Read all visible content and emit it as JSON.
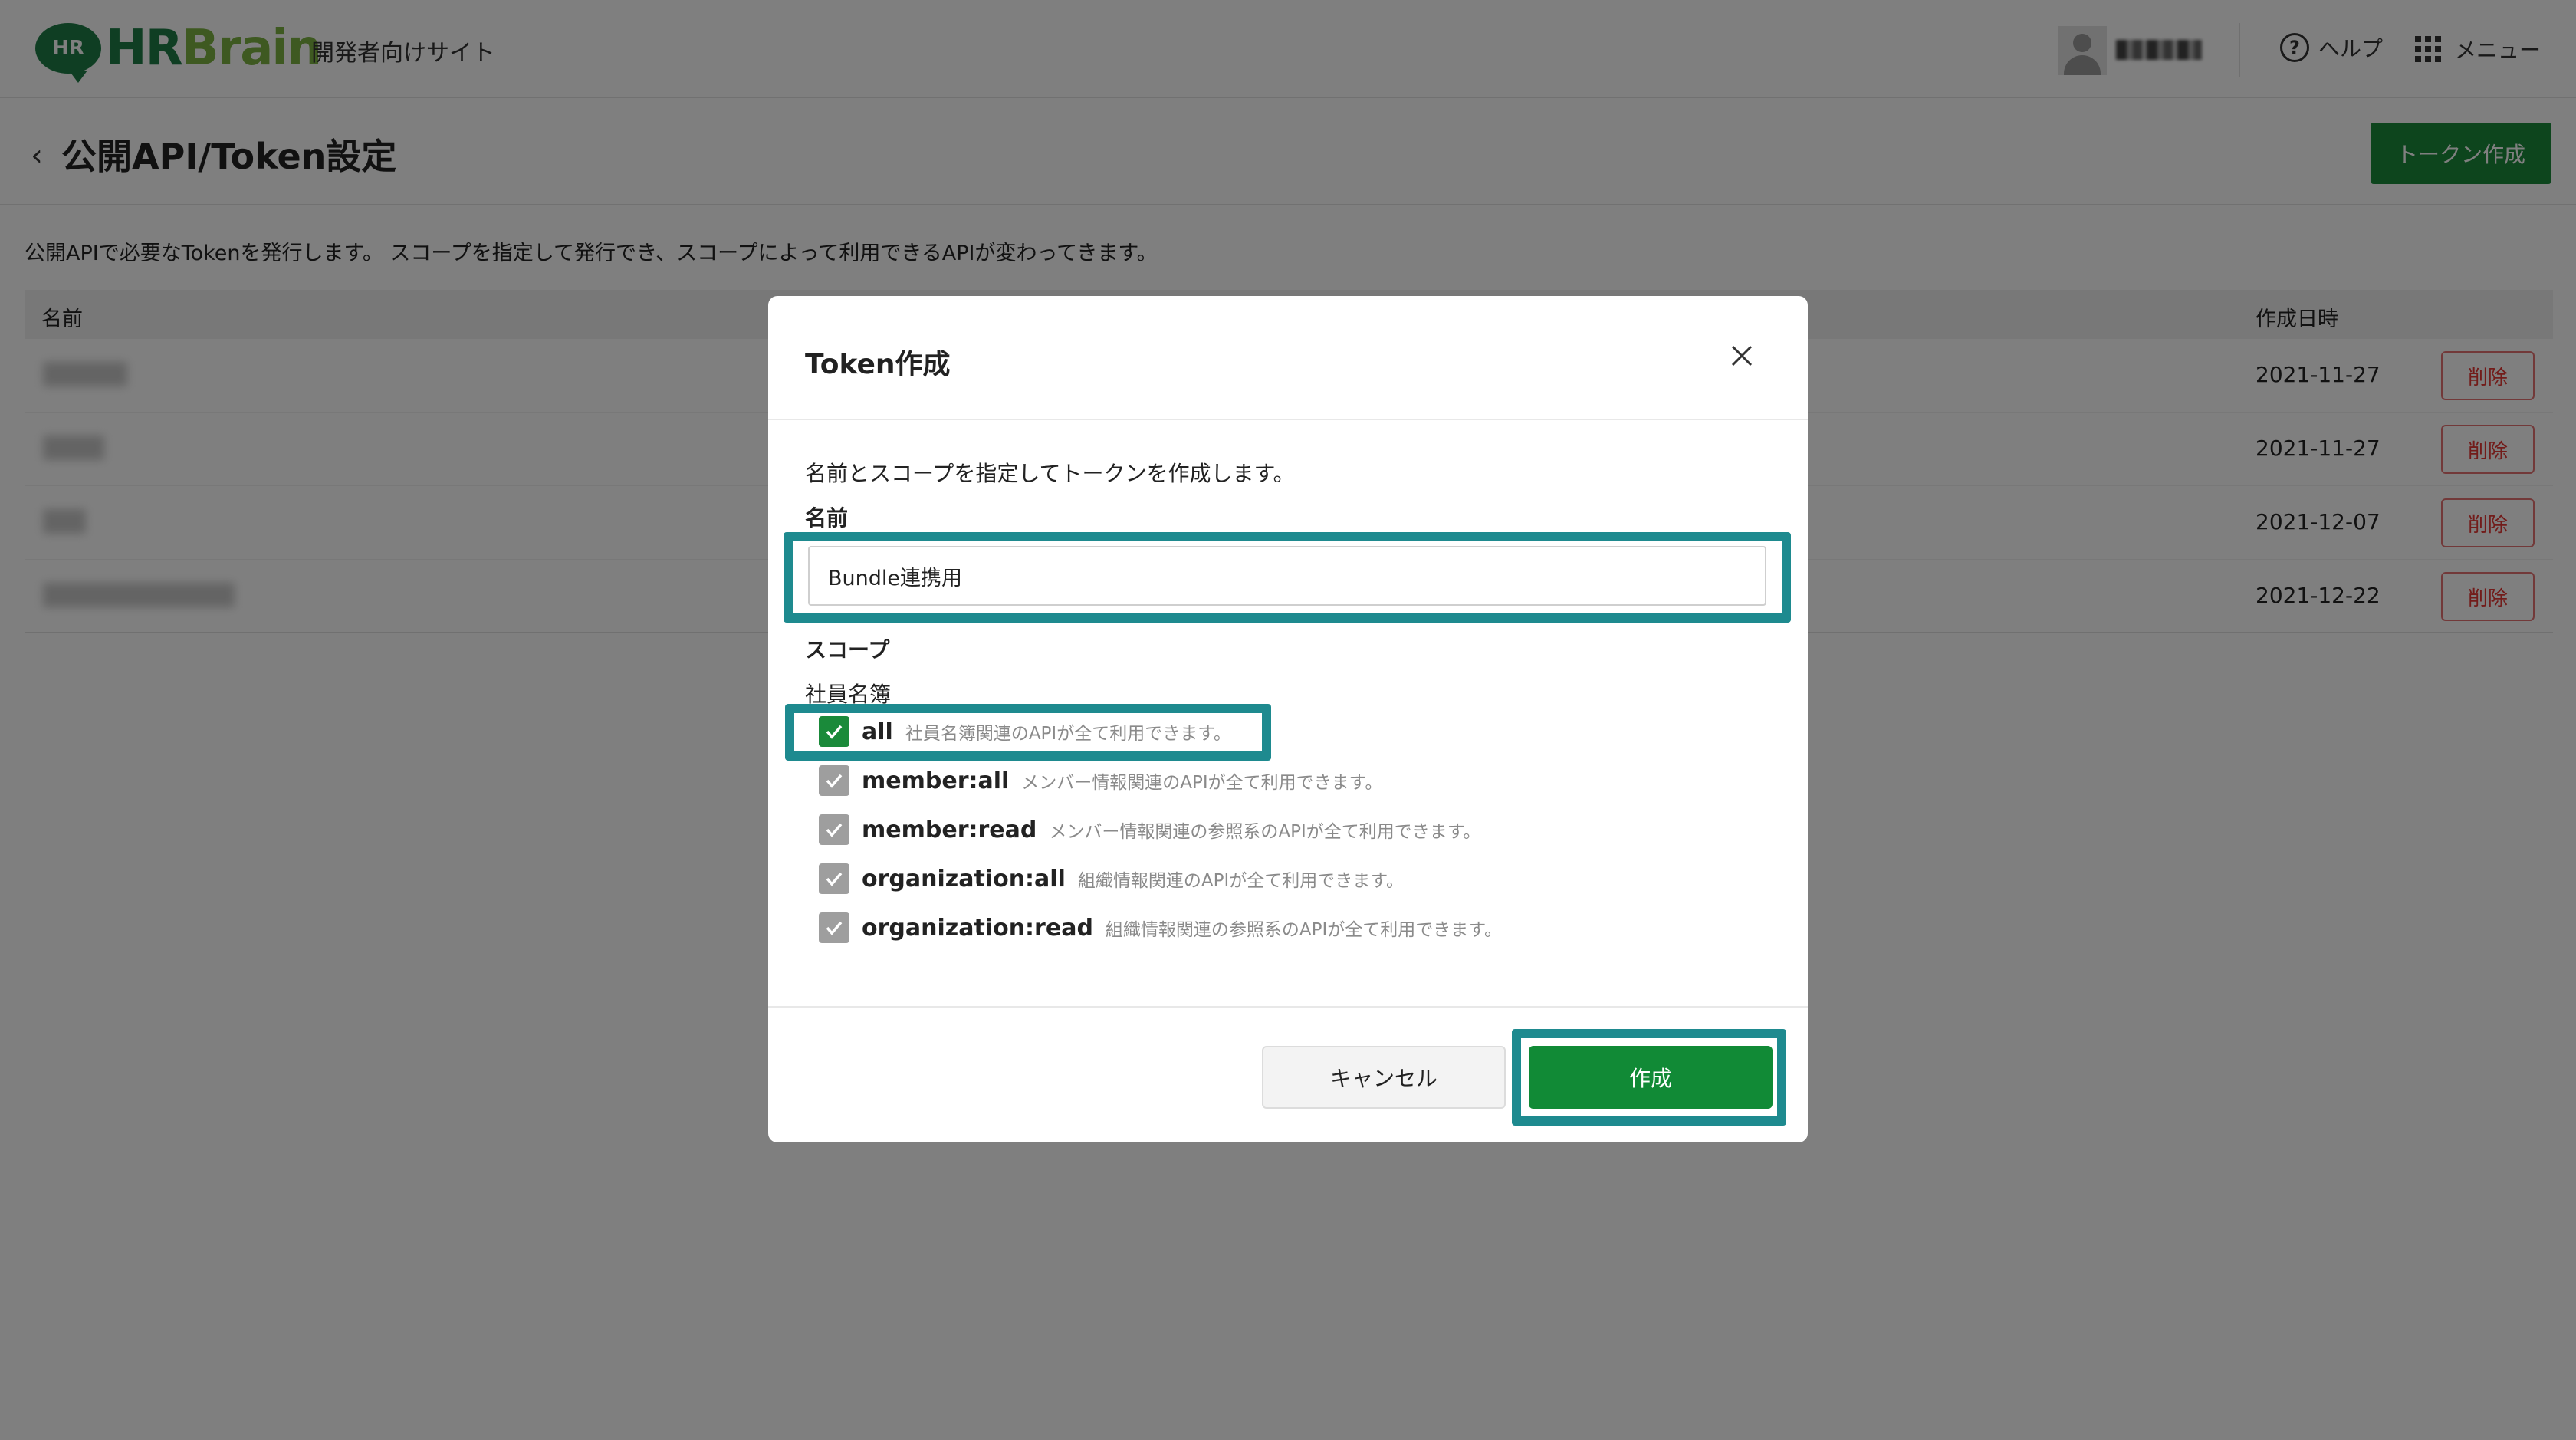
{
  "header": {
    "logo_badge": "HR",
    "logo_hr": "HR",
    "logo_brain": "Brain",
    "site_name": "開発者向けサイト",
    "help_label": "ヘルプ",
    "menu_label": "メニュー"
  },
  "page": {
    "title": "公開API/Token設定",
    "create_token_button": "トークン作成",
    "description": "公開APIで必要なTokenを発行します。 スコープを指定して発行でき、スコープによって利用できるAPIが変わってきます。"
  },
  "table": {
    "col_name": "名前",
    "col_date": "作成日時",
    "delete_label": "削除",
    "rows": [
      {
        "date": "2021-11-27"
      },
      {
        "date": "2021-11-27"
      },
      {
        "date": "2021-12-07"
      },
      {
        "date": "2021-12-22"
      }
    ]
  },
  "modal": {
    "title": "Token作成",
    "description": "名前とスコープを指定してトークンを作成します。",
    "name_label": "名前",
    "name_value": "Bundle連携用",
    "scope_label": "スコープ",
    "group_label": "社員名簿",
    "scopes": [
      {
        "name": "all",
        "desc": "社員名簿関連のAPIが全て利用できます。",
        "checked": true
      },
      {
        "name": "member:all",
        "desc": "メンバー情報関連のAPIが全て利用できます。",
        "checked": true
      },
      {
        "name": "member:read",
        "desc": "メンバー情報関連の参照系のAPIが全て利用できます。",
        "checked": true
      },
      {
        "name": "organization:all",
        "desc": "組織情報関連のAPIが全て利用できます。",
        "checked": true
      },
      {
        "name": "organization:read",
        "desc": "組織情報関連の参照系のAPIが全て利用できます。",
        "checked": true
      }
    ],
    "cancel_label": "キャンセル",
    "create_label": "作成"
  },
  "colors": {
    "brand_green": "#1a8a3a",
    "highlight": "#1e8a8f",
    "danger": "#e53935"
  }
}
